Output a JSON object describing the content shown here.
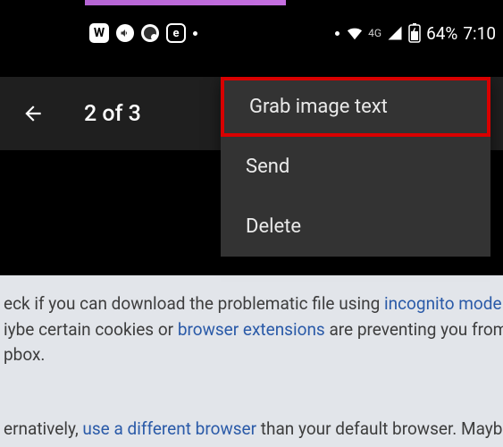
{
  "status_bar": {
    "icons": {
      "w_badge": "W",
      "mute": "mute-icon",
      "dnd": "dnd-icon",
      "e_badge": "e"
    },
    "network_label": "4G",
    "battery_percent": "64%",
    "time": "7:10"
  },
  "app_bar": {
    "counter": "2 of 3"
  },
  "menu": {
    "items": [
      {
        "label": "Grab image text",
        "highlighted": true
      },
      {
        "label": "Send",
        "highlighted": false
      },
      {
        "label": "Delete",
        "highlighted": false
      }
    ]
  },
  "content": {
    "line1_a": "eck if you can download the problematic file using ",
    "line1_b": "incognito mode",
    "line2_a": "iybe certain cookies or ",
    "line2_b": "browser extensions",
    "line2_c": " are preventing you from",
    "line3": "pbox.",
    "line4_a": "ernatively, ",
    "line4_b": "use a different browser",
    "line4_c": " than your default browser. Mayb"
  }
}
